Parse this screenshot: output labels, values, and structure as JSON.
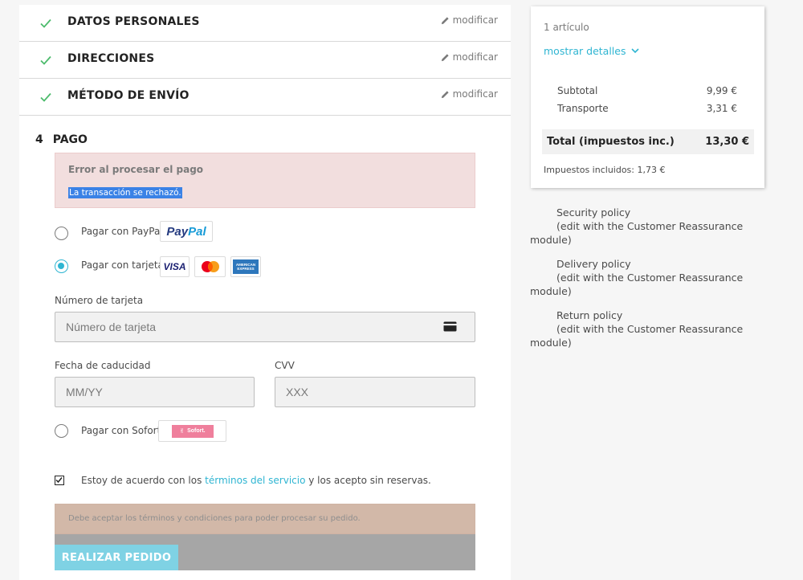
{
  "steps": [
    {
      "title": "DATOS PERSONALES",
      "edit": "modificar"
    },
    {
      "title": "DIRECCIONES",
      "edit": "modificar"
    },
    {
      "title": "MÉTODO DE ENVÍO",
      "edit": "modificar"
    }
  ],
  "payment": {
    "number": "4",
    "title": "PAGO",
    "error_title": "Error al procesar el pago",
    "error_message": "La transacción se rechazó.",
    "options": [
      {
        "label": "Pagar con PayPal",
        "selected": false,
        "badges": [
          "PayPal"
        ]
      },
      {
        "label": "Pagar con tarjeta",
        "selected": true,
        "badges": [
          "VISA",
          "mastercard-icon",
          "AMERICAN EXPRESS"
        ]
      },
      {
        "label": "Pagar con Sofort",
        "selected": false,
        "badges": [
          "Sofort."
        ]
      }
    ],
    "card_number_label": "Número de tarjeta",
    "card_number_placeholder": "Número de tarjeta",
    "expiry_label": "Fecha de caducidad",
    "expiry_placeholder": "MM/YY",
    "cvv_label": "CVV",
    "cvv_placeholder": "XXX",
    "terms_prefix": "Estoy de acuerdo con los ",
    "terms_link": "términos del servicio",
    "terms_suffix": " y los acepto sin reservas.",
    "terms_checked": true,
    "warning": "Debe aceptar los términos y condiciones para poder procesar su pedido.",
    "order_button": "REALIZAR PEDIDO"
  },
  "summary": {
    "items_count": "1 artículo",
    "show_details": "mostrar detalles",
    "subtotal_label": "Subtotal",
    "subtotal_value": "9,99 €",
    "shipping_label": "Transporte",
    "shipping_value": "3,31 €",
    "total_label": "Total (impuestos inc.)",
    "total_value": "13,30 €",
    "taxes": "Impuestos incluidos: 1,73 €"
  },
  "reassurance": [
    {
      "title": "Security policy",
      "subtitle": "(edit with the Customer Reassurance module)"
    },
    {
      "title": "Delivery policy",
      "subtitle": "(edit with the Customer Reassurance module)"
    },
    {
      "title": "Return policy",
      "subtitle": "(edit with the Customer Reassurance module)"
    }
  ],
  "colors": {
    "accent": "#2fb5d2",
    "success": "#4cbb6c",
    "error_bg": "#f2dede"
  }
}
